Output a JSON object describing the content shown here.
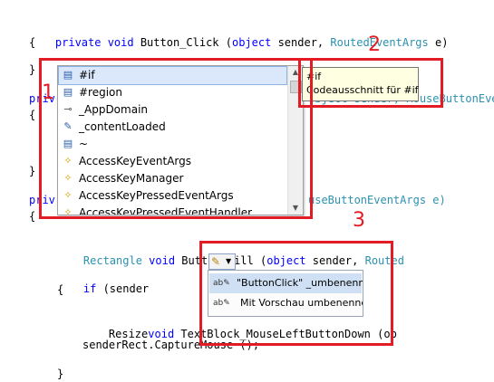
{
  "code": {
    "line1": {
      "kw": "private void",
      "name": " Button_Click (",
      "obj": "object",
      "sender": " sender, ",
      "args": "RoutedEventArgs",
      "end": " e)"
    },
    "brace_open_1": "{",
    "brace_close_1": "}",
    "line_priv_2_frag": "priv",
    "line_2_right": "object sender, MouseButtonEve",
    "brace_open_2": "{",
    "brace_close_2": "}",
    "line_priv_3_frag": "priv",
    "line_3_right": "useButtonEventArgs e)",
    "brace_open_3": "{",
    "rect_type": "Rectangle",
    "rect_kw": " void",
    "rect_name": " Button_Fill (",
    "rect_obj": "object",
    "rect_sender": " sender, ",
    "rect_args": "Routed",
    "if_line": "if (sender",
    "brace_open_4": "{",
    "resize_a": "Resize",
    "resize_kw": "void",
    "resize_b": " TextBlock_MouseLeftButtonDown (ob",
    "capture_line": "senderRect.CaptureMouse ();",
    "brace_close_end": "}"
  },
  "completion_list": {
    "items": [
      {
        "icon": "snippet-icon",
        "glyph": "▤",
        "label": "#if"
      },
      {
        "icon": "snippet-icon",
        "glyph": "▤",
        "label": "#region"
      },
      {
        "icon": "field-icon",
        "glyph": "⊸",
        "label": "_AppDomain"
      },
      {
        "icon": "property-icon",
        "glyph": "✎",
        "label": "_contentLoaded"
      },
      {
        "icon": "snippet-icon",
        "glyph": "▤",
        "label": "~"
      },
      {
        "icon": "class-icon",
        "glyph": "✧",
        "label": "AccessKeyEventArgs"
      },
      {
        "icon": "class-icon",
        "glyph": "✧",
        "label": "AccessKeyManager"
      },
      {
        "icon": "class-icon",
        "glyph": "✧",
        "label": "AccessKeyPressedEventArgs"
      },
      {
        "icon": "class-icon",
        "glyph": "✧",
        "label": "AccessKeyPressedEventHandler"
      }
    ]
  },
  "tooltip": {
    "line1": "#if",
    "line2": "Codeausschnitt für #if"
  },
  "smart_tag": {
    "icon": "smart-tag-icon",
    "menu": [
      {
        "icon": "rename-icon",
        "glyph": "ab✎",
        "label": "\"ButtonClick\" _umbenennen"
      },
      {
        "icon": "rename-preview-icon",
        "glyph": "ab✎",
        "label": "Mit Vorschau umbenennen"
      }
    ]
  },
  "annotations": [
    "1",
    "2",
    "3"
  ],
  "colors": {
    "keyword": "#0000ff",
    "type": "#2b91af",
    "annotation": "#e21b24",
    "selection": "#dbe8fb"
  }
}
